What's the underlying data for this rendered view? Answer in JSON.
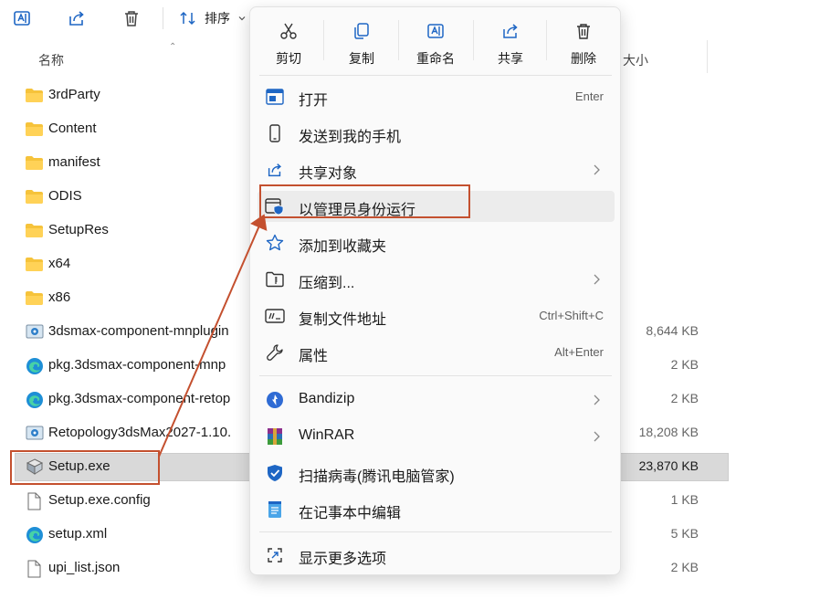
{
  "toolbar": {
    "rename_icon": "rename-icon",
    "share_icon": "share-icon",
    "delete_icon": "trash-icon",
    "sort_label": "排序"
  },
  "columns": {
    "name": "名称",
    "size": "大小"
  },
  "files": [
    {
      "name": "3rdParty",
      "type": "folder",
      "size": ""
    },
    {
      "name": "Content",
      "type": "folder",
      "size": ""
    },
    {
      "name": "manifest",
      "type": "folder",
      "size": ""
    },
    {
      "name": "ODIS",
      "type": "folder",
      "size": ""
    },
    {
      "name": "SetupRes",
      "type": "folder",
      "size": ""
    },
    {
      "name": "x64",
      "type": "folder",
      "size": ""
    },
    {
      "name": "x86",
      "type": "folder",
      "size": ""
    },
    {
      "name": "3dsmax-component-mnplugin",
      "type": "installer",
      "size": "8,644 KB"
    },
    {
      "name": "pkg.3dsmax-component-mnp",
      "type": "edge",
      "size": "2 KB"
    },
    {
      "name": "pkg.3dsmax-component-retop",
      "type": "edge",
      "size": "2 KB"
    },
    {
      "name": "Retopology3dsMax2027-1.10.",
      "type": "installer",
      "size": "18,208 KB"
    },
    {
      "name": "Setup.exe",
      "type": "exe",
      "size": "23,870 KB",
      "selected": true
    },
    {
      "name": "Setup.exe.config",
      "type": "doc",
      "size": "1 KB"
    },
    {
      "name": "setup.xml",
      "type": "edge",
      "size": "5 KB"
    },
    {
      "name": "upi_list.json",
      "type": "doc",
      "size": "2 KB"
    }
  ],
  "context_menu": {
    "quick_actions": [
      {
        "label": "剪切",
        "icon": "scissors-icon"
      },
      {
        "label": "复制",
        "icon": "copy-icon"
      },
      {
        "label": "重命名",
        "icon": "rename-icon"
      },
      {
        "label": "共享",
        "icon": "share-icon"
      },
      {
        "label": "删除",
        "icon": "trash-icon"
      }
    ],
    "items": [
      {
        "label": "打开",
        "icon": "open-app-icon",
        "shortcut": "Enter"
      },
      {
        "label": "发送到我的手机",
        "icon": "phone-icon"
      },
      {
        "label": "共享对象",
        "icon": "share-icon",
        "submenu": true
      },
      {
        "label": "以管理员身份运行",
        "icon": "admin-shield-icon",
        "hover": true
      },
      {
        "label": "添加到收藏夹",
        "icon": "star-icon"
      },
      {
        "label": "压缩到...",
        "icon": "zip-folder-icon",
        "submenu": true
      },
      {
        "label": "复制文件地址",
        "icon": "copy-path-icon",
        "shortcut": "Ctrl+Shift+C"
      },
      {
        "label": "属性",
        "icon": "wrench-icon",
        "shortcut": "Alt+Enter"
      },
      {
        "label": "Bandizip",
        "icon": "bandizip-icon",
        "submenu": true
      },
      {
        "label": "WinRAR",
        "icon": "winrar-icon",
        "submenu": true
      },
      {
        "label": "扫描病毒(腾讯电脑管家)",
        "icon": "tencent-shield-icon"
      },
      {
        "label": "在记事本中编辑",
        "icon": "notepad-icon"
      },
      {
        "label": "显示更多选项",
        "icon": "more-options-icon"
      }
    ]
  },
  "colors": {
    "annotation": "#c4502f",
    "accent": "#0067c0",
    "folder": "#f6c33b",
    "selection": "#d9d9d9"
  }
}
